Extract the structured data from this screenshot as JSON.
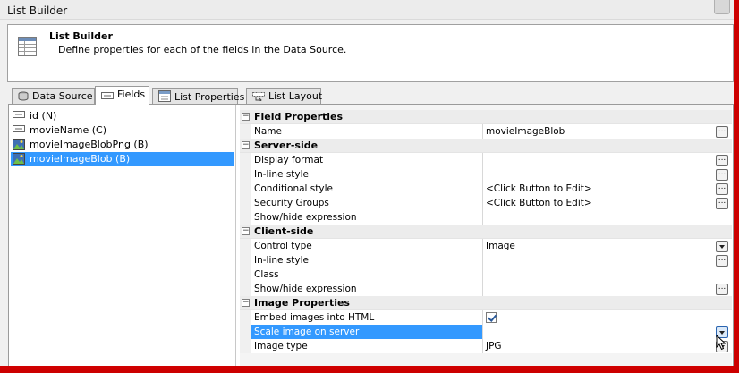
{
  "window": {
    "title": "List Builder"
  },
  "header": {
    "title": "List Builder",
    "description": "Define properties for each of the fields in the Data Source."
  },
  "tabs": [
    {
      "label": "Data Source",
      "icon": "database-icon"
    },
    {
      "label": "Fields",
      "icon": "fields-icon",
      "active": true
    },
    {
      "label": "List Properties",
      "icon": "properties-icon"
    },
    {
      "label": "List Layout",
      "icon": "layout-icon"
    }
  ],
  "fields": [
    {
      "label": "id (N)",
      "icon": "text-field-icon"
    },
    {
      "label": "movieName (C)",
      "icon": "text-field-icon"
    },
    {
      "label": "movieImageBlobPng (B)",
      "icon": "image-field-icon"
    },
    {
      "label": "movieImageBlob (B)",
      "icon": "image-field-icon",
      "selected": true
    }
  ],
  "grid": {
    "categories": {
      "field_properties": "Field Properties",
      "server_side": "Server-side",
      "client_side": "Client-side",
      "image_properties": "Image Properties"
    },
    "rows": {
      "name": {
        "label": "Name",
        "value": "movieImageBlob"
      },
      "display_format": {
        "label": "Display format",
        "value": ""
      },
      "inline_style": {
        "label": "In-line style",
        "value": ""
      },
      "conditional_style": {
        "label": "Conditional style",
        "value": "<Click Button to Edit>"
      },
      "security_groups": {
        "label": "Security Groups",
        "value": "<Click Button to Edit>"
      },
      "show_hide_server": {
        "label": "Show/hide expression",
        "value": ""
      },
      "control_type": {
        "label": "Control type",
        "value": "Image"
      },
      "inline_style_client": {
        "label": "In-line style",
        "value": ""
      },
      "class": {
        "label": "Class",
        "value": ""
      },
      "show_hide_client": {
        "label": "Show/hide expression",
        "value": ""
      },
      "embed_images": {
        "label": "Embed images into HTML",
        "checked": true
      },
      "scale_image": {
        "label": "Scale image on server",
        "value": ""
      },
      "image_type": {
        "label": "Image type",
        "value": "JPG"
      }
    },
    "ellipsis": "..."
  },
  "colors": {
    "selection": "#3399ff",
    "frame": "#cc0000"
  }
}
